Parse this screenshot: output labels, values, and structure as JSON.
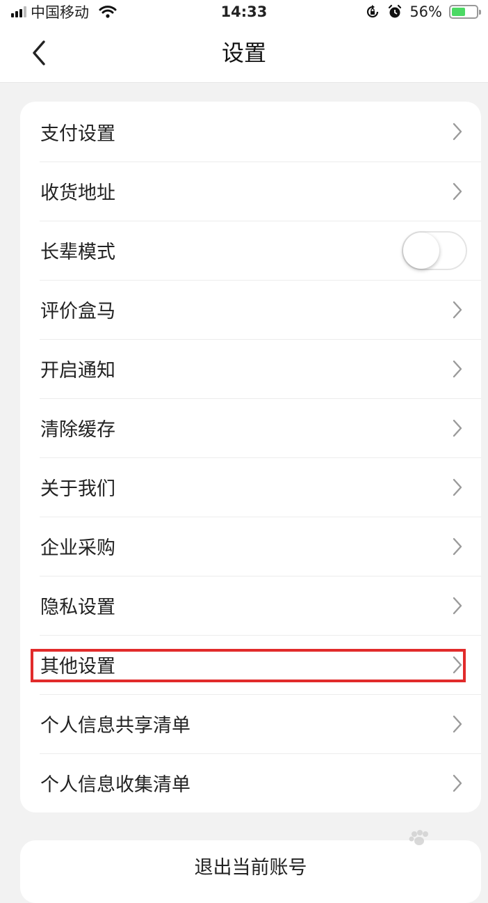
{
  "status_bar": {
    "carrier": "中国移动",
    "time": "14:33",
    "battery_percent": "56%",
    "battery_level": 0.56,
    "icons": [
      "signal-icon",
      "wifi-icon",
      "rotation-lock-icon",
      "alarm-icon",
      "battery-icon"
    ]
  },
  "nav": {
    "title": "设置",
    "back_icon": "chevron-left-icon"
  },
  "settings": {
    "items": [
      {
        "label": "支付设置",
        "control": "chevron"
      },
      {
        "label": "收货地址",
        "control": "chevron"
      },
      {
        "label": "长辈模式",
        "control": "toggle",
        "toggle_on": false
      },
      {
        "label": "评价盒马",
        "control": "chevron"
      },
      {
        "label": "开启通知",
        "control": "chevron"
      },
      {
        "label": "清除缓存",
        "control": "chevron"
      },
      {
        "label": "关于我们",
        "control": "chevron"
      },
      {
        "label": "企业采购",
        "control": "chevron"
      },
      {
        "label": "隐私设置",
        "control": "chevron"
      },
      {
        "label": "其他设置",
        "control": "chevron",
        "highlighted": true
      },
      {
        "label": "个人信息共享清单",
        "control": "chevron"
      },
      {
        "label": "个人信息收集清单",
        "control": "chevron"
      }
    ]
  },
  "logout": {
    "label": "退出当前账号"
  },
  "colors": {
    "background": "#f2f2f2",
    "card": "#ffffff",
    "highlight_border": "#e12b2b",
    "battery_fill": "#4cd964"
  }
}
